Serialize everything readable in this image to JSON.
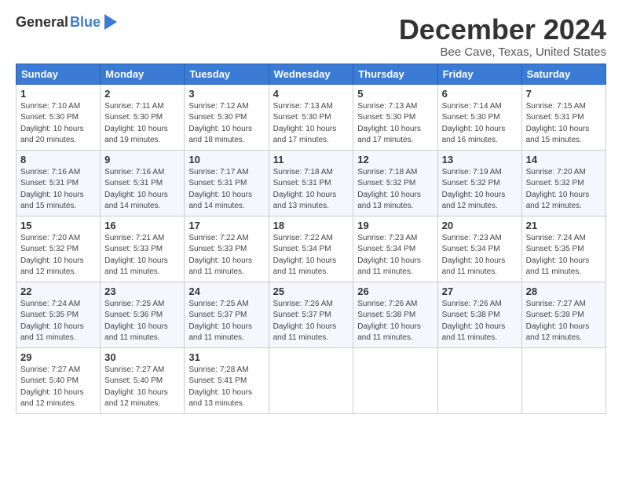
{
  "logo": {
    "general": "General",
    "blue": "Blue"
  },
  "title": "December 2024",
  "subtitle": "Bee Cave, Texas, United States",
  "days_header": [
    "Sunday",
    "Monday",
    "Tuesday",
    "Wednesday",
    "Thursday",
    "Friday",
    "Saturday"
  ],
  "weeks": [
    [
      {
        "day": "1",
        "sunrise": "7:10 AM",
        "sunset": "5:30 PM",
        "daylight": "10 hours and 20 minutes."
      },
      {
        "day": "2",
        "sunrise": "7:11 AM",
        "sunset": "5:30 PM",
        "daylight": "10 hours and 19 minutes."
      },
      {
        "day": "3",
        "sunrise": "7:12 AM",
        "sunset": "5:30 PM",
        "daylight": "10 hours and 18 minutes."
      },
      {
        "day": "4",
        "sunrise": "7:13 AM",
        "sunset": "5:30 PM",
        "daylight": "10 hours and 17 minutes."
      },
      {
        "day": "5",
        "sunrise": "7:13 AM",
        "sunset": "5:30 PM",
        "daylight": "10 hours and 17 minutes."
      },
      {
        "day": "6",
        "sunrise": "7:14 AM",
        "sunset": "5:30 PM",
        "daylight": "10 hours and 16 minutes."
      },
      {
        "day": "7",
        "sunrise": "7:15 AM",
        "sunset": "5:31 PM",
        "daylight": "10 hours and 15 minutes."
      }
    ],
    [
      {
        "day": "8",
        "sunrise": "7:16 AM",
        "sunset": "5:31 PM",
        "daylight": "10 hours and 15 minutes."
      },
      {
        "day": "9",
        "sunrise": "7:16 AM",
        "sunset": "5:31 PM",
        "daylight": "10 hours and 14 minutes."
      },
      {
        "day": "10",
        "sunrise": "7:17 AM",
        "sunset": "5:31 PM",
        "daylight": "10 hours and 14 minutes."
      },
      {
        "day": "11",
        "sunrise": "7:18 AM",
        "sunset": "5:31 PM",
        "daylight": "10 hours and 13 minutes."
      },
      {
        "day": "12",
        "sunrise": "7:18 AM",
        "sunset": "5:32 PM",
        "daylight": "10 hours and 13 minutes."
      },
      {
        "day": "13",
        "sunrise": "7:19 AM",
        "sunset": "5:32 PM",
        "daylight": "10 hours and 12 minutes."
      },
      {
        "day": "14",
        "sunrise": "7:20 AM",
        "sunset": "5:32 PM",
        "daylight": "10 hours and 12 minutes."
      }
    ],
    [
      {
        "day": "15",
        "sunrise": "7:20 AM",
        "sunset": "5:32 PM",
        "daylight": "10 hours and 12 minutes."
      },
      {
        "day": "16",
        "sunrise": "7:21 AM",
        "sunset": "5:33 PM",
        "daylight": "10 hours and 11 minutes."
      },
      {
        "day": "17",
        "sunrise": "7:22 AM",
        "sunset": "5:33 PM",
        "daylight": "10 hours and 11 minutes."
      },
      {
        "day": "18",
        "sunrise": "7:22 AM",
        "sunset": "5:34 PM",
        "daylight": "10 hours and 11 minutes."
      },
      {
        "day": "19",
        "sunrise": "7:23 AM",
        "sunset": "5:34 PM",
        "daylight": "10 hours and 11 minutes."
      },
      {
        "day": "20",
        "sunrise": "7:23 AM",
        "sunset": "5:34 PM",
        "daylight": "10 hours and 11 minutes."
      },
      {
        "day": "21",
        "sunrise": "7:24 AM",
        "sunset": "5:35 PM",
        "daylight": "10 hours and 11 minutes."
      }
    ],
    [
      {
        "day": "22",
        "sunrise": "7:24 AM",
        "sunset": "5:35 PM",
        "daylight": "10 hours and 11 minutes."
      },
      {
        "day": "23",
        "sunrise": "7:25 AM",
        "sunset": "5:36 PM",
        "daylight": "10 hours and 11 minutes."
      },
      {
        "day": "24",
        "sunrise": "7:25 AM",
        "sunset": "5:37 PM",
        "daylight": "10 hours and 11 minutes."
      },
      {
        "day": "25",
        "sunrise": "7:26 AM",
        "sunset": "5:37 PM",
        "daylight": "10 hours and 11 minutes."
      },
      {
        "day": "26",
        "sunrise": "7:26 AM",
        "sunset": "5:38 PM",
        "daylight": "10 hours and 11 minutes."
      },
      {
        "day": "27",
        "sunrise": "7:26 AM",
        "sunset": "5:38 PM",
        "daylight": "10 hours and 11 minutes."
      },
      {
        "day": "28",
        "sunrise": "7:27 AM",
        "sunset": "5:39 PM",
        "daylight": "10 hours and 12 minutes."
      }
    ],
    [
      {
        "day": "29",
        "sunrise": "7:27 AM",
        "sunset": "5:40 PM",
        "daylight": "10 hours and 12 minutes."
      },
      {
        "day": "30",
        "sunrise": "7:27 AM",
        "sunset": "5:40 PM",
        "daylight": "10 hours and 12 minutes."
      },
      {
        "day": "31",
        "sunrise": "7:28 AM",
        "sunset": "5:41 PM",
        "daylight": "10 hours and 13 minutes."
      },
      null,
      null,
      null,
      null
    ]
  ],
  "labels": {
    "sunrise": "Sunrise:",
    "sunset": "Sunset:",
    "daylight": "Daylight:"
  }
}
